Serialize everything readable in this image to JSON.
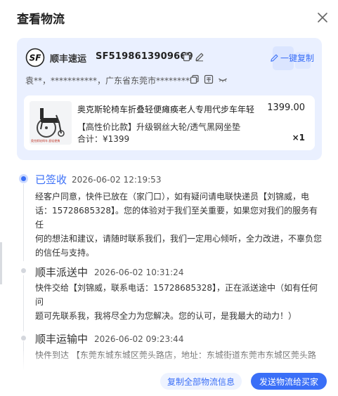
{
  "dialog": {
    "title": "查看物流"
  },
  "card": {
    "carrier_name": "顺丰速运",
    "waybill_no": "SF5198613909669",
    "copy_all_label": "一键复制",
    "address": "袁**，***********，广东省东莞市**********",
    "product": {
      "name": "奥克斯轮椅车折叠轻便瘫痪老人专用代步车年轻",
      "price": "1399.00",
      "spec": "【高性价比款】升级钢丝大轮/透气黑网坐垫",
      "total": "合计：¥1399",
      "qty": "×1",
      "thumb_caption": "奥克斯轮椅车 超轻便携"
    }
  },
  "tracking": [
    {
      "status": "已签收",
      "time": "2026-06-02 12:19:53",
      "lines": [
        "经客户同意，快件已放在（家门口），如有疑问请电联快递员【刘锦威，电",
        "话：15728685328】。您的体验对于我们至关重要，如果您对我们的服务有任",
        "何的想法和建议，请随时联系我们，我们一定用心倾听，全力改进，不辜负您",
        "的信任与支持。"
      ]
    },
    {
      "status": "顺丰派送中",
      "time": "2026-06-02 10:31:24",
      "lines": [
        "快件交给【刘锦威，联系电话：15728685328】，正在派送途中（如有任何问",
        "题可先联系我，我将尽全力为您解决。您的认可，是我最大的动力！）"
      ]
    },
    {
      "status": "顺丰运输中",
      "time": "2026-06-02 09:23:44",
      "lines": [
        "快件到达 【东莞东城东城区莞头路店，地址：东城街道东莞市东城区莞头路"
      ]
    }
  ],
  "footer": {
    "copy_all_tracking_label": "复制全部物流信息",
    "send_to_buyer_label": "发送物流给买家"
  },
  "colors": {
    "accent": "#3a6ff7",
    "card_bg": "#eaf0ff"
  }
}
